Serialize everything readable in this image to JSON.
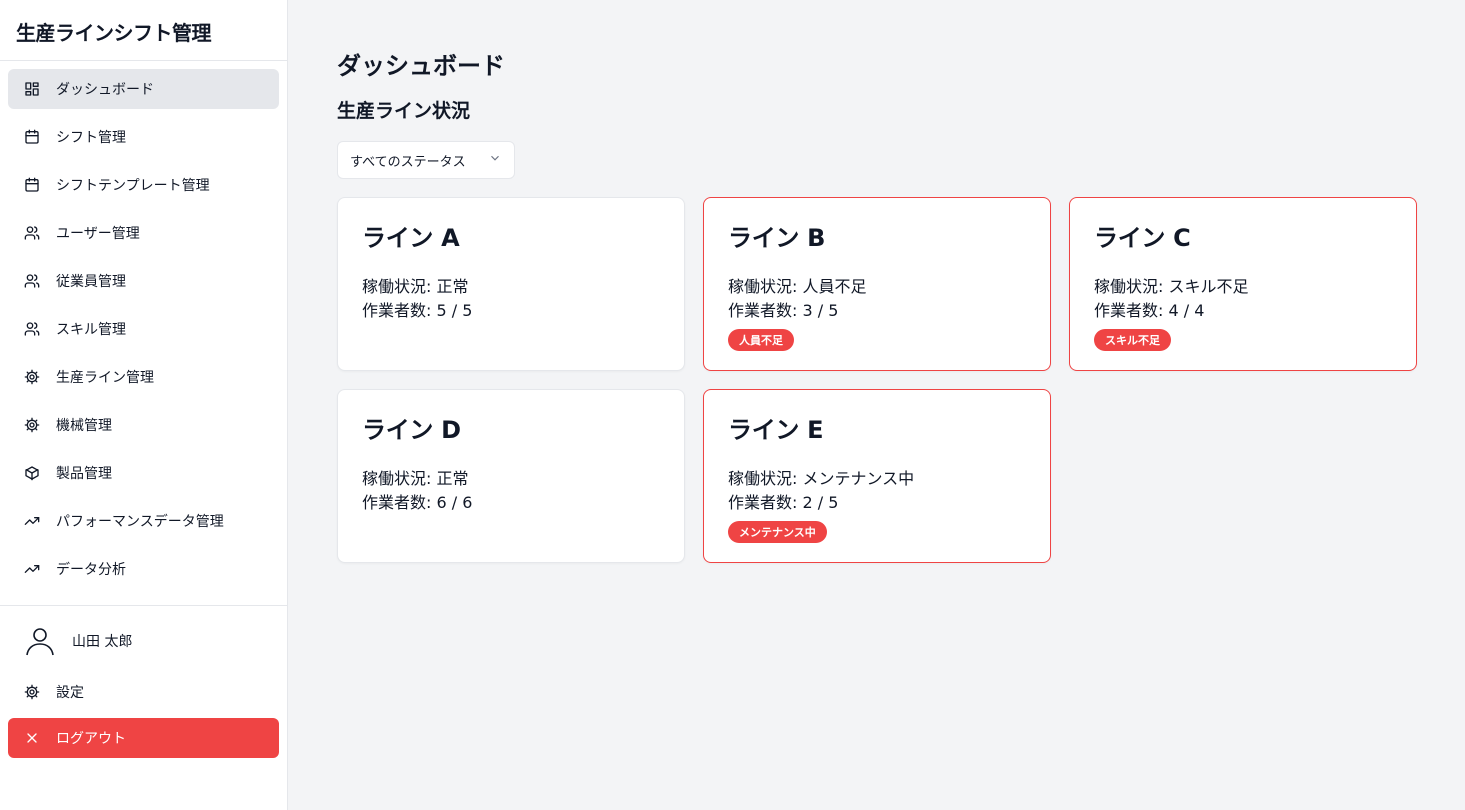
{
  "app": {
    "title": "生産ラインシフト管理"
  },
  "sidebar": {
    "items": [
      {
        "label": "ダッシュボード",
        "icon": "dashboard-icon",
        "active": true
      },
      {
        "label": "シフト管理",
        "icon": "calendar-icon"
      },
      {
        "label": "シフトテンプレート管理",
        "icon": "calendar-icon"
      },
      {
        "label": "ユーザー管理",
        "icon": "users-icon"
      },
      {
        "label": "従業員管理",
        "icon": "users-icon"
      },
      {
        "label": "スキル管理",
        "icon": "users-icon"
      },
      {
        "label": "生産ライン管理",
        "icon": "gear-icon"
      },
      {
        "label": "機械管理",
        "icon": "gear-icon"
      },
      {
        "label": "製品管理",
        "icon": "package-icon"
      },
      {
        "label": "パフォーマンスデータ管理",
        "icon": "trending-up-icon"
      },
      {
        "label": "データ分析",
        "icon": "trending-up-icon"
      }
    ],
    "user": {
      "name": "山田 太郎"
    },
    "settings_label": "設定",
    "logout_label": "ログアウト"
  },
  "main": {
    "page_title": "ダッシュボード",
    "section_title": "生産ライン状況",
    "filter": {
      "selected": "すべてのステータス"
    },
    "lines": [
      {
        "name": "ライン A",
        "status": "稼働状況: 正常",
        "workers": "作業者数: 5 / 5",
        "badge": ""
      },
      {
        "name": "ライン B",
        "status": "稼働状況: 人員不足",
        "workers": "作業者数: 3 / 5",
        "badge": "人員不足"
      },
      {
        "name": "ライン C",
        "status": "稼働状況: スキル不足",
        "workers": "作業者数: 4 / 4",
        "badge": "スキル不足"
      },
      {
        "name": "ライン D",
        "status": "稼働状況: 正常",
        "workers": "作業者数: 6 / 6",
        "badge": ""
      },
      {
        "name": "ライン E",
        "status": "稼働状況: メンテナンス中",
        "workers": "作業者数: 2 / 5",
        "badge": "メンテナンス中"
      }
    ]
  },
  "colors": {
    "alert": "#ef4444",
    "active_nav": "#e5e7eb",
    "background": "#f3f4f6"
  }
}
